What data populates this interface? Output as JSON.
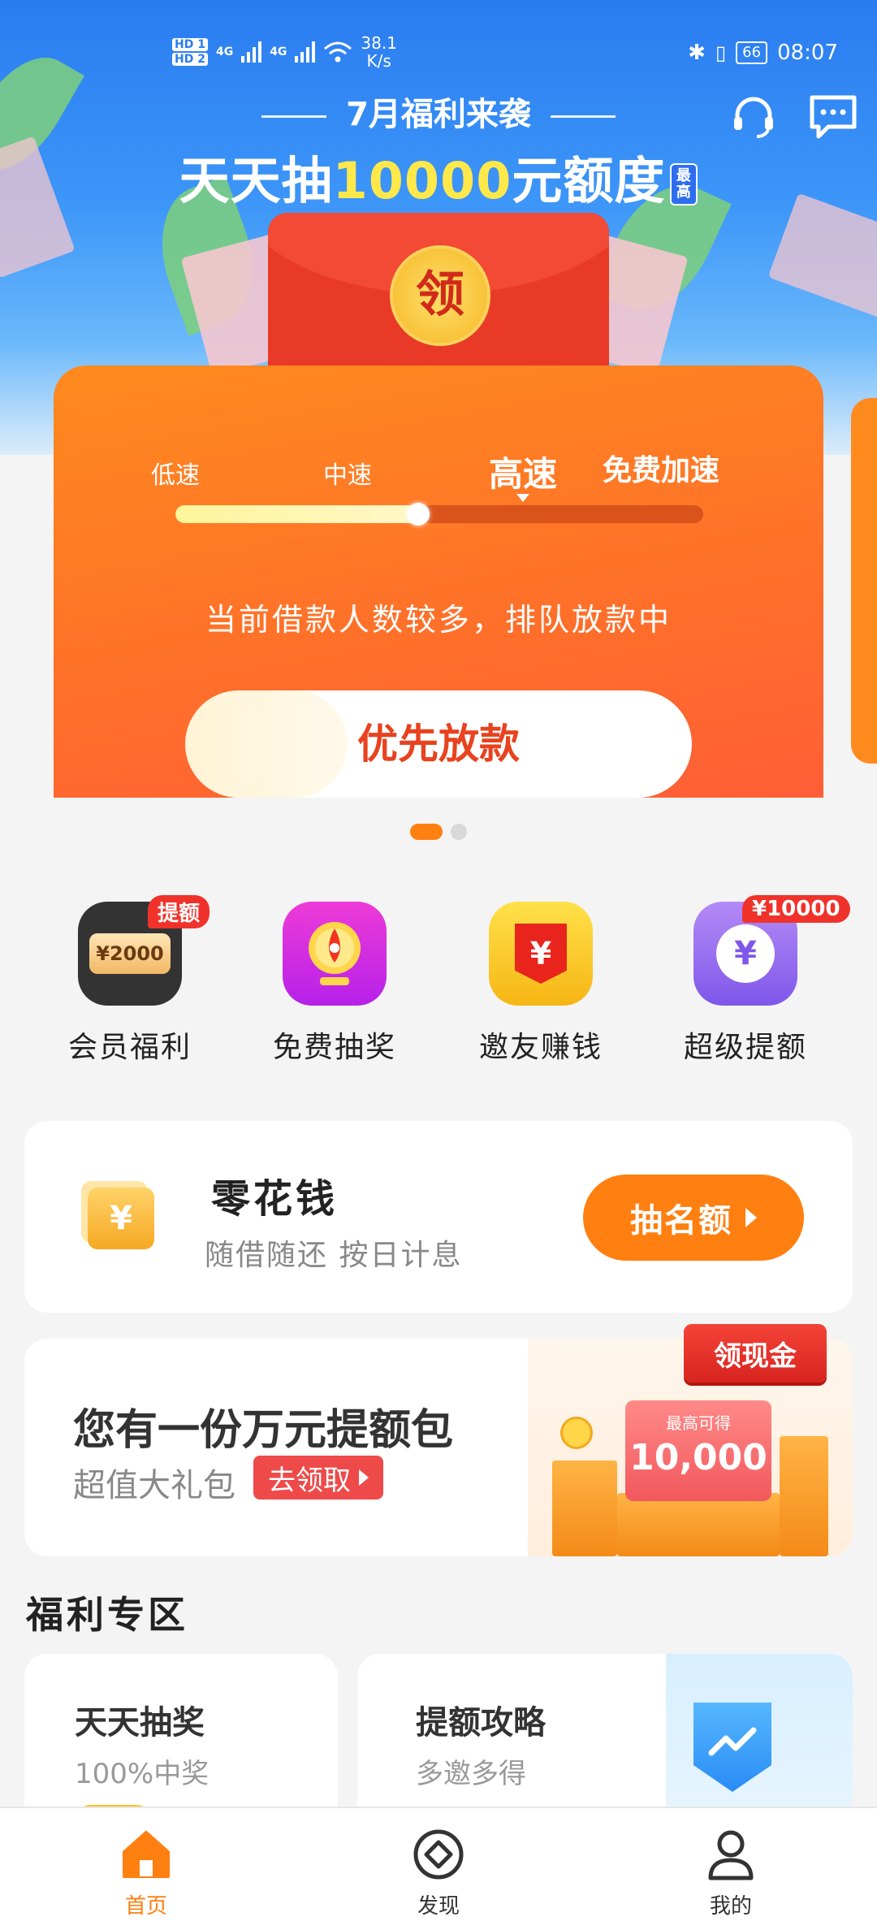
{
  "status_bar": {
    "sim1": "HD 1",
    "sim2": "HD 2",
    "net1": "4G",
    "net2": "4G",
    "speed_value": "38.1",
    "speed_unit": "K/s",
    "battery": "66",
    "time": "08:07"
  },
  "banner": {
    "subtitle": "7月福利来袭",
    "title_pre": "天天抽",
    "title_highlight": "10000",
    "title_post": "元额度",
    "tag": "最高",
    "seal_char": "领"
  },
  "speed_card": {
    "labels": [
      "低速",
      "中速",
      "高速",
      "免费加速"
    ],
    "progress": 0.46,
    "message": "当前借款人数较多，排队放款中",
    "button": "优先放款"
  },
  "carousel": {
    "count": 2,
    "active": 0
  },
  "quick_entries": [
    {
      "label": "会员福利",
      "badge": "提额",
      "icon": "vip-card-icon",
      "plate": "¥2000"
    },
    {
      "label": "免费抽奖",
      "badge": "",
      "icon": "lottery-wheel-icon"
    },
    {
      "label": "邀友赚钱",
      "badge": "",
      "icon": "red-packet-icon",
      "symbol": "¥"
    },
    {
      "label": "超级提额",
      "badge": "¥10000",
      "icon": "limit-up-icon",
      "symbol": "¥"
    }
  ],
  "product": {
    "icon_symbol": "¥",
    "name": "零花钱",
    "desc": "随借随还 按日计息",
    "button": "抽名额"
  },
  "gift_pack": {
    "title": "您有一份万元提额包",
    "subtitle": "超值大礼包",
    "cta": "去领取",
    "slip_small": "最高可得",
    "slip_big": "10,000",
    "cash_tag": "领现金"
  },
  "welfare": {
    "section_title": "福利专区",
    "left": {
      "title": "天天抽奖",
      "sub": "100%中奖"
    },
    "right": {
      "title": "提额攻略",
      "sub": "多邀多得"
    }
  },
  "nav": [
    {
      "label": "首页",
      "icon": "home-icon",
      "active": true
    },
    {
      "label": "发现",
      "icon": "discover-icon",
      "active": false
    },
    {
      "label": "我的",
      "icon": "profile-icon",
      "active": false
    }
  ],
  "colors": {
    "accent": "#ff7f10",
    "banner_blue": "#2a7cf0",
    "red": "#e93a28"
  }
}
